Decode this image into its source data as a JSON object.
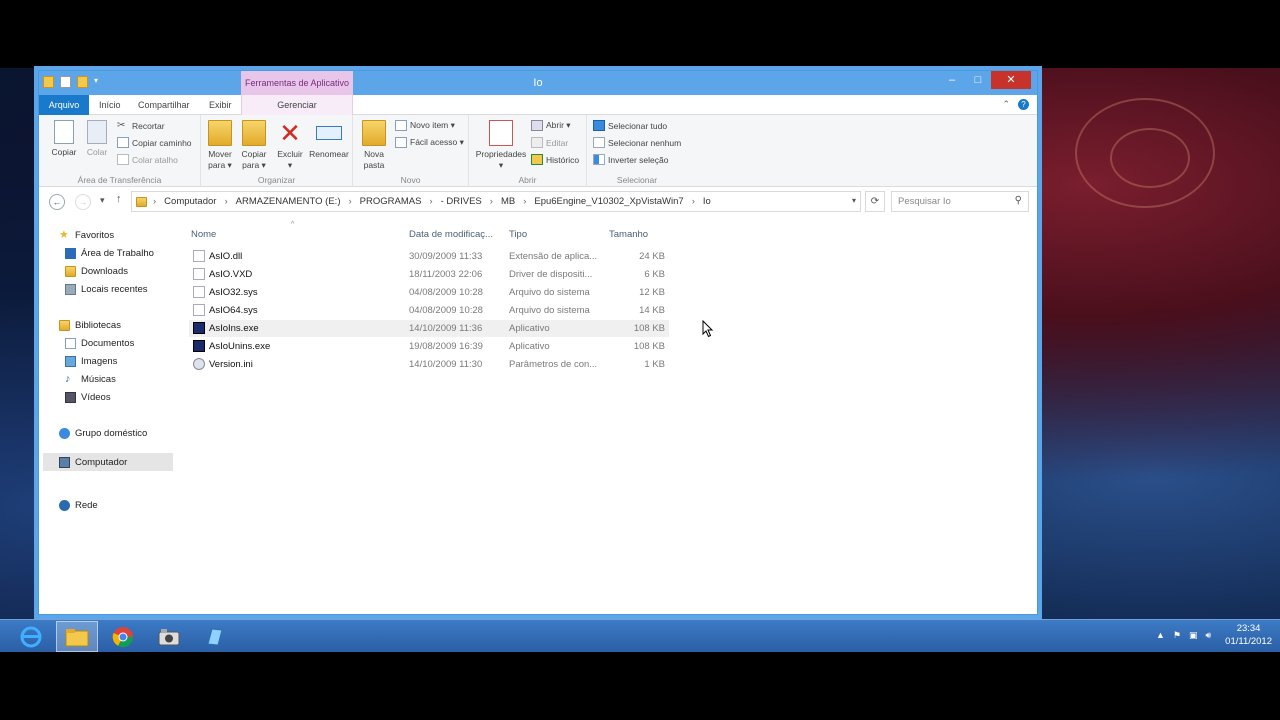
{
  "window": {
    "title": "Io",
    "context_tab_header": "Ferramentas de Aplicativo",
    "minimize": "‒",
    "maximize": "□",
    "close": "✕"
  },
  "ribbon_tabs": {
    "file": "Arquivo",
    "home": "Início",
    "share": "Compartilhar",
    "view": "Exibir",
    "manage": "Gerenciar"
  },
  "ribbon": {
    "clipboard": {
      "label": "Área de Transferência",
      "copy": "Copiar",
      "paste": "Colar",
      "cut": "Recortar",
      "copy_path": "Copiar caminho",
      "paste_shortcut": "Colar atalho"
    },
    "organize": {
      "label": "Organizar",
      "move_to": "Mover\npara ▾",
      "copy_to": "Copiar\npara ▾",
      "delete": "Excluir\n▾",
      "rename": "Renomear"
    },
    "new": {
      "label": "Novo",
      "new_folder": "Nova\npasta",
      "new_item": "Novo item ▾",
      "easy_access": "Fácil acesso ▾"
    },
    "open": {
      "label": "Abrir",
      "properties": "Propriedades\n▾",
      "open": "Abrir ▾",
      "edit": "Editar",
      "history": "Histórico"
    },
    "select": {
      "label": "Selecionar",
      "select_all": "Selecionar tudo",
      "select_none": "Selecionar nenhum",
      "invert": "Inverter seleção"
    }
  },
  "address": {
    "crumbs": [
      "Computador",
      "ARMAZENAMENTO (E:)",
      "PROGRAMAS",
      "- DRIVES",
      "MB",
      "Epu6Engine_V10302_XpVistaWin7",
      "Io"
    ],
    "search_placeholder": "Pesquisar Io"
  },
  "navpane": {
    "favorites": "Favoritos",
    "desktop": "Área de Trabalho",
    "downloads": "Downloads",
    "recent": "Locais recentes",
    "libraries": "Bibliotecas",
    "documents": "Documentos",
    "pictures": "Imagens",
    "music": "Músicas",
    "videos": "Vídeos",
    "homegroup": "Grupo doméstico",
    "computer": "Computador",
    "network": "Rede"
  },
  "columns": {
    "name": "Nome",
    "date": "Data de modificaç...",
    "type": "Tipo",
    "size": "Tamanho"
  },
  "files": [
    {
      "name": "AsIO.dll",
      "date": "30/09/2009 11:33",
      "type": "Extensão de aplica...",
      "size": "24 KB"
    },
    {
      "name": "AsIO.VXD",
      "date": "18/11/2003 22:06",
      "type": "Driver de dispositi...",
      "size": "6 KB"
    },
    {
      "name": "AsIO32.sys",
      "date": "04/08/2009 10:28",
      "type": "Arquivo do sistema",
      "size": "12 KB"
    },
    {
      "name": "AsIO64.sys",
      "date": "04/08/2009 10:28",
      "type": "Arquivo do sistema",
      "size": "14 KB"
    },
    {
      "name": "AsIoIns.exe",
      "date": "14/10/2009 11:36",
      "type": "Aplicativo",
      "size": "108 KB"
    },
    {
      "name": "AsIoUnins.exe",
      "date": "19/08/2009 16:39",
      "type": "Aplicativo",
      "size": "108 KB"
    },
    {
      "name": "Version.ini",
      "date": "14/10/2009 11:30",
      "type": "Parâmetros de con...",
      "size": "1 KB"
    }
  ],
  "taskbar": {
    "time": "23:34",
    "date": "01/11/2012"
  },
  "colors": {
    "accent": "#1979ca",
    "titlebar": "#5ba5e8",
    "context_tab": "#e8c6ea",
    "taskbar": "#2a5fa5"
  }
}
